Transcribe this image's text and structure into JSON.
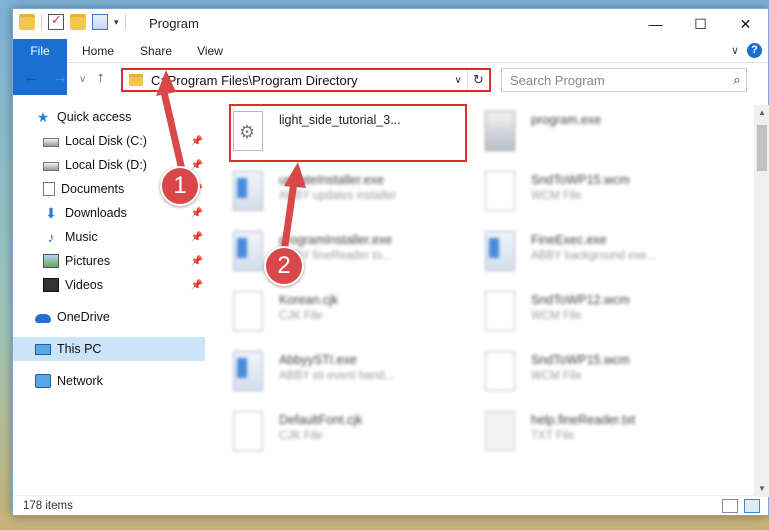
{
  "window": {
    "title": "Program",
    "controls": {
      "minimize": "—",
      "maximize": "☐",
      "close": "✕"
    }
  },
  "ribbon": {
    "tabs": [
      {
        "label": "File",
        "active": true
      },
      {
        "label": "Home"
      },
      {
        "label": "Share"
      },
      {
        "label": "View"
      }
    ]
  },
  "navigation": {
    "back": "←",
    "forward": "→",
    "recent": "∨",
    "up": "↑",
    "address": "C:\\Program Files\\Program Directory",
    "search_placeholder": "Search Program"
  },
  "sidebar": {
    "items": [
      {
        "label": "Quick access",
        "icon": "star-icon"
      },
      {
        "label": "Local Disk (C:)",
        "icon": "disk-icon",
        "pinned": true
      },
      {
        "label": "Local Disk (D:)",
        "icon": "disk-icon",
        "pinned": true
      },
      {
        "label": "Documents",
        "icon": "documents-icon",
        "pinned": true
      },
      {
        "label": "Downloads",
        "icon": "download-icon",
        "pinned": true
      },
      {
        "label": "Music",
        "icon": "music-icon",
        "pinned": true
      },
      {
        "label": "Pictures",
        "icon": "pictures-icon",
        "pinned": true
      },
      {
        "label": "Videos",
        "icon": "videos-icon",
        "pinned": true
      },
      {
        "label": "OneDrive",
        "icon": "onedrive-icon"
      },
      {
        "label": "This PC",
        "icon": "this-pc-icon",
        "selected": true
      },
      {
        "label": "Network",
        "icon": "network-icon"
      }
    ]
  },
  "files": {
    "items": [
      {
        "name": "light_side_tutorial_3...",
        "description": "",
        "icon": "settings-file-icon",
        "highlighted": true
      },
      {
        "name": "program.exe",
        "description": "",
        "icon": "program-icon"
      },
      {
        "name": "updateInstaller.exe",
        "description": "ABBY updates installer",
        "icon": "exe-icon"
      },
      {
        "name": "SndToWP15.wcm",
        "description": "WCM File",
        "icon": "file-icon"
      },
      {
        "name": "programInstaller.exe",
        "description": "ABBY fineReader to...",
        "icon": "exe-icon"
      },
      {
        "name": "FineExec.exe",
        "description": "ABBY background exe...",
        "icon": "exe-icon"
      },
      {
        "name": "Korean.cjk",
        "description": "CJK File",
        "icon": "file-icon"
      },
      {
        "name": "SndToWP12.wcm",
        "description": "WCM File",
        "icon": "file-icon"
      },
      {
        "name": "AbbyySTI.exe",
        "description": "ABBY sti event hand...",
        "icon": "exe-icon"
      },
      {
        "name": "SndToWP15.wcm",
        "description": "WCM File",
        "icon": "file-icon"
      },
      {
        "name": "DefaultFont.cjk",
        "description": "CJK File",
        "icon": "file-icon"
      },
      {
        "name": "help.fineReader.txt",
        "description": "TXT File",
        "icon": "text-file-icon"
      }
    ]
  },
  "status": {
    "item_count": "178 items"
  },
  "annotations": {
    "badge_1": "1",
    "badge_2": "2",
    "accent_color": "#e02b2b"
  },
  "colors": {
    "file_tab": "#1a6fd1",
    "selected_nav": "#cce4f7",
    "highlight_box": "#e02b2b"
  }
}
